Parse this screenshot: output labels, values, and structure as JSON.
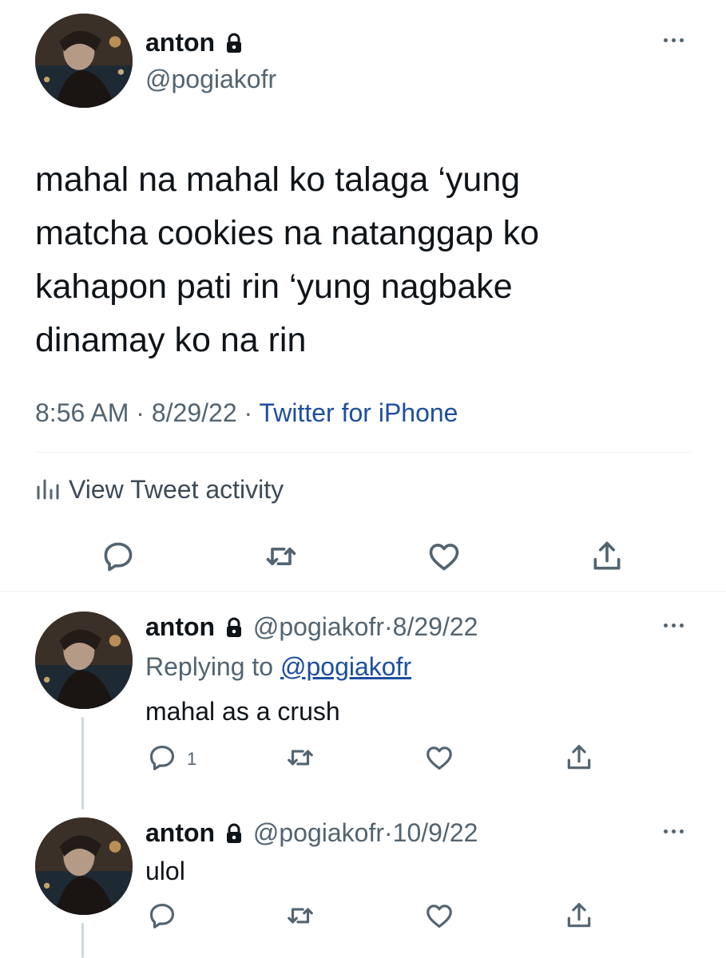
{
  "main_tweet": {
    "author_name": "anton",
    "handle": "@pogiakofr",
    "text_lines": [
      "mahal na mahal ko talaga ‘yung",
      "matcha cookies na natanggap ko",
      "kahapon pati rin ‘yung nagbake",
      "dinamay ko na rin"
    ],
    "time": "8:56 AM",
    "date": "8/29/22",
    "separator": "·",
    "source": "Twitter for iPhone",
    "activity_label": "View Tweet activity"
  },
  "replies": [
    {
      "author_name": "anton",
      "handle": "@pogiakofr",
      "date": "8/29/22",
      "replying_prefix": "Replying to",
      "replying_to": "@pogiakofr",
      "text": "mahal as a crush",
      "reply_count": "1"
    },
    {
      "author_name": "anton",
      "handle": "@pogiakofr",
      "date": "10/9/22",
      "text": "ulol"
    }
  ],
  "colors": {
    "text": "#0f1419",
    "secondary": "#536471",
    "source_link": "#1d4f9e",
    "divider": "#eff3f4",
    "thread_line": "#cfd9de"
  },
  "icons": [
    "lock-icon",
    "more-icon",
    "reply-icon",
    "retweet-icon",
    "like-icon",
    "share-icon",
    "analytics-icon"
  ]
}
